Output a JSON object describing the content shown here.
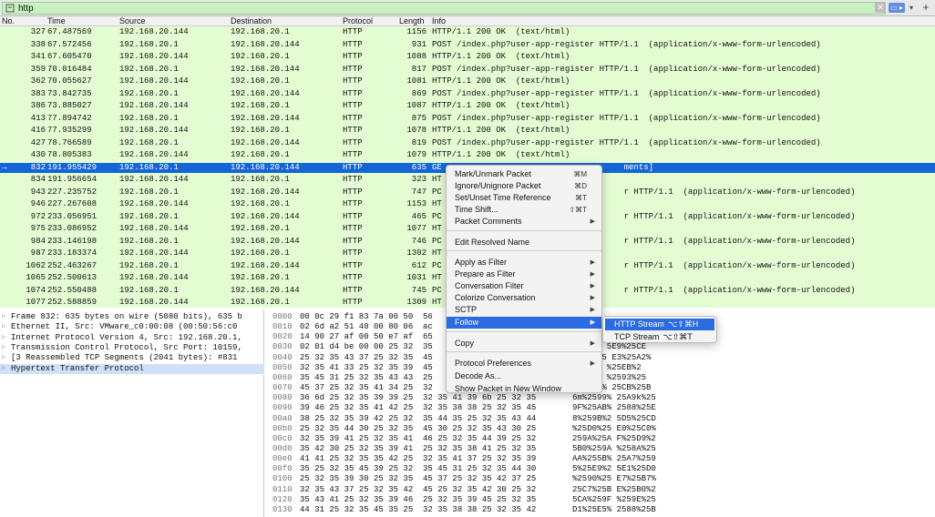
{
  "filter": {
    "value": "http",
    "apply_label": "▭ ▸",
    "clear_label": "✕",
    "dropdown_label": "▾",
    "add_label": "+"
  },
  "columns": [
    "No.",
    "Time",
    "Source",
    "Destination",
    "Protocol",
    "Length",
    "Info"
  ],
  "packets": [
    {
      "no": "327",
      "time": "67.487569",
      "src": "192.168.20.144",
      "dst": "192.168.20.1",
      "proto": "HTTP",
      "len": "1156",
      "info": "HTTP/1.1 200 OK  (text/html)"
    },
    {
      "no": "338",
      "time": "67.572456",
      "src": "192.168.20.1",
      "dst": "192.168.20.144",
      "proto": "HTTP",
      "len": "931",
      "info": "POST /index.php?user-app-register HTTP/1.1  (application/x-www-form-urlencoded)"
    },
    {
      "no": "341",
      "time": "67.605470",
      "src": "192.168.20.144",
      "dst": "192.168.20.1",
      "proto": "HTTP",
      "len": "1088",
      "info": "HTTP/1.1 200 OK  (text/html)"
    },
    {
      "no": "359",
      "time": "70.016484",
      "src": "192.168.20.1",
      "dst": "192.168.20.144",
      "proto": "HTTP",
      "len": "817",
      "info": "POST /index.php?user-app-register HTTP/1.1  (application/x-www-form-urlencoded)"
    },
    {
      "no": "362",
      "time": "70.055627",
      "src": "192.168.20.144",
      "dst": "192.168.20.1",
      "proto": "HTTP",
      "len": "1081",
      "info": "HTTP/1.1 200 OK  (text/html)"
    },
    {
      "no": "383",
      "time": "73.842735",
      "src": "192.168.20.1",
      "dst": "192.168.20.144",
      "proto": "HTTP",
      "len": "869",
      "info": "POST /index.php?user-app-register HTTP/1.1  (application/x-www-form-urlencoded)"
    },
    {
      "no": "386",
      "time": "73.885027",
      "src": "192.168.20.144",
      "dst": "192.168.20.1",
      "proto": "HTTP",
      "len": "1087",
      "info": "HTTP/1.1 200 OK  (text/html)"
    },
    {
      "no": "413",
      "time": "77.894742",
      "src": "192.168.20.1",
      "dst": "192.168.20.144",
      "proto": "HTTP",
      "len": "875",
      "info": "POST /index.php?user-app-register HTTP/1.1  (application/x-www-form-urlencoded)"
    },
    {
      "no": "416",
      "time": "77.935299",
      "src": "192.168.20.144",
      "dst": "192.168.20.1",
      "proto": "HTTP",
      "len": "1078",
      "info": "HTTP/1.1 200 OK  (text/html)"
    },
    {
      "no": "427",
      "time": "78.766589",
      "src": "192.168.20.1",
      "dst": "192.168.20.144",
      "proto": "HTTP",
      "len": "819",
      "info": "POST /index.php?user-app-register HTTP/1.1  (application/x-www-form-urlencoded)"
    },
    {
      "no": "430",
      "time": "78.805383",
      "src": "192.168.20.144",
      "dst": "192.168.20.1",
      "proto": "HTTP",
      "len": "1079",
      "info": "HTTP/1.1 200 OK  (text/html)"
    },
    {
      "no": "832",
      "time": "191.955429",
      "src": "192.168.20.1",
      "dst": "192.168.20.144",
      "proto": "HTTP",
      "len": "635",
      "info": "GE                                     ments]",
      "selected": true
    },
    {
      "no": "834",
      "time": "191.956654",
      "src": "192.168.20.144",
      "dst": "192.168.20.1",
      "proto": "HTTP",
      "len": "323",
      "info": "HT"
    },
    {
      "no": "943",
      "time": "227.235752",
      "src": "192.168.20.1",
      "dst": "192.168.20.144",
      "proto": "HTTP",
      "len": "747",
      "info": "PC                                     r HTTP/1.1  (application/x-www-form-urlencoded)"
    },
    {
      "no": "946",
      "time": "227.267608",
      "src": "192.168.20.144",
      "dst": "192.168.20.1",
      "proto": "HTTP",
      "len": "1153",
      "info": "HT"
    },
    {
      "no": "972",
      "time": "233.056951",
      "src": "192.168.20.1",
      "dst": "192.168.20.144",
      "proto": "HTTP",
      "len": "465",
      "info": "PC                                     r HTTP/1.1  (application/x-www-form-urlencoded)"
    },
    {
      "no": "975",
      "time": "233.086952",
      "src": "192.168.20.144",
      "dst": "192.168.20.1",
      "proto": "HTTP",
      "len": "1077",
      "info": "HT"
    },
    {
      "no": "984",
      "time": "233.146198",
      "src": "192.168.20.1",
      "dst": "192.168.20.144",
      "proto": "HTTP",
      "len": "746",
      "info": "PC                                     r HTTP/1.1  (application/x-www-form-urlencoded)"
    },
    {
      "no": "987",
      "time": "233.183374",
      "src": "192.168.20.144",
      "dst": "192.168.20.1",
      "proto": "HTTP",
      "len": "1302",
      "info": "HT"
    },
    {
      "no": "1062",
      "time": "252.463267",
      "src": "192.168.20.1",
      "dst": "192.168.20.144",
      "proto": "HTTP",
      "len": "612",
      "info": "PC                                     r HTTP/1.1  (application/x-www-form-urlencoded)"
    },
    {
      "no": "1065",
      "time": "252.500613",
      "src": "192.168.20.144",
      "dst": "192.168.20.1",
      "proto": "HTTP",
      "len": "1031",
      "info": "HT"
    },
    {
      "no": "1074",
      "time": "252.550488",
      "src": "192.168.20.1",
      "dst": "192.168.20.144",
      "proto": "HTTP",
      "len": "745",
      "info": "PC                                     r HTTP/1.1  (application/x-www-form-urlencoded)"
    },
    {
      "no": "1077",
      "time": "252.588859",
      "src": "192.168.20.144",
      "dst": "192.168.20.1",
      "proto": "HTTP",
      "len": "1309",
      "info": "HT"
    }
  ],
  "details": [
    {
      "text": "Frame 832: 635 bytes on wire (5080 bits), 635 b"
    },
    {
      "text": "Ethernet II, Src: VMware_c0:00:08 (00:50:56:c0"
    },
    {
      "text": "Internet Protocol Version 4, Src: 192.168.20.1,"
    },
    {
      "text": "Transmission Control Protocol, Src Port: 10159,"
    },
    {
      "text": "[3 Reassembled TCP Segments (2041 bytes): #831"
    },
    {
      "text": "Hypertext Transfer Protocol",
      "selected": true
    }
  ],
  "hex": [
    {
      "off": "0000",
      "bytes": "00 0c 29 f1 83 7a 00 50  56",
      "ascii": ""
    },
    {
      "off": "0010",
      "bytes": "02 6d a2 51 40 00 80 06  ac",
      "ascii": ""
    },
    {
      "off": "0020",
      "bytes": "14 90 27 af 00 50 e7 af  65",
      "ascii": ""
    },
    {
      "off": "0030",
      "bytes": "02 01 d4 be 00 00 25 32  35",
      "ascii": "    %2 5E9%25CE"
    },
    {
      "off": "0040",
      "bytes": "25 32 35 43 37 25 32 35  45",
      "ascii": "    %25 E3%25A2%"
    },
    {
      "off": "0050",
      "bytes": "32 35 41 33 25 32 35 39  45",
      "ascii": "    59 %25EB%2"
    },
    {
      "off": "0060",
      "bytes": "35 45 31 25 32 35 43 43  25",
      "ascii": "    CC %2593%25"
    },
    {
      "off": "0070",
      "bytes": "45 37 25 32 35 41 34 25  32",
      "ascii": "    %4% 25CB%25B"
    },
    {
      "off": "0080",
      "bytes": "36 6d 25 32 35 39 39 25  32 35 41 39 6b 25 32 35",
      "ascii": "6m%2599% 25A9k%25"
    },
    {
      "off": "0090",
      "bytes": "39 46 25 32 35 41 42 25  32 35 38 38 25 32 35 45",
      "ascii": "9F%25AB% 2588%25E"
    },
    {
      "off": "00a0",
      "bytes": "38 25 32 35 39 42 25 32  35 44 35 25 32 35 43 44",
      "ascii": "8%259B%2 5D5%25CD"
    },
    {
      "off": "00b0",
      "bytes": "25 32 35 44 30 25 32 35  45 30 25 32 35 43 30 25",
      "ascii": "%25D0%25 E0%25C0%"
    },
    {
      "off": "00c0",
      "bytes": "32 35 39 41 25 32 35 41  46 25 32 35 44 39 25 32",
      "ascii": "259A%25A F%25D9%2"
    },
    {
      "off": "00d0",
      "bytes": "35 42 30 25 32 35 39 41  25 32 35 38 41 25 32 35",
      "ascii": "5B0%259A %258A%25"
    },
    {
      "off": "00e0",
      "bytes": "41 41 25 32 35 35 42 25  32 35 41 37 25 32 35 39",
      "ascii": "AA%255B% 25A7%259"
    },
    {
      "off": "00f0",
      "bytes": "35 25 32 35 45 39 25 32  35 45 31 25 32 35 44 30",
      "ascii": "5%25E9%2 5E1%25D0"
    },
    {
      "off": "0100",
      "bytes": "25 32 35 39 30 25 32 35  45 37 25 32 35 42 37 25",
      "ascii": "%2590%25 E7%25B7%"
    },
    {
      "off": "0110",
      "bytes": "32 35 43 37 25 32 35 42  45 25 32 35 42 30 25 32",
      "ascii": "25C7%25B E%25B0%2"
    },
    {
      "off": "0120",
      "bytes": "35 43 41 25 32 35 39 46  25 32 35 39 45 25 32 35",
      "ascii": "5CA%259F %259E%25"
    },
    {
      "off": "0130",
      "bytes": "44 31 25 32 35 45 35 25  32 35 38 38 25 32 35 42",
      "ascii": "D1%25E5% 2588%25B"
    }
  ],
  "context_menu": {
    "items": [
      {
        "label": "Mark/Unmark Packet",
        "shortcut": "⌘M"
      },
      {
        "label": "Ignore/Unignore Packet",
        "shortcut": "⌘D"
      },
      {
        "label": "Set/Unset Time Reference",
        "shortcut": "⌘T"
      },
      {
        "label": "Time Shift...",
        "shortcut": "⇧⌘T"
      },
      {
        "label": "Packet Comments",
        "submenu": true
      },
      {
        "label": "Edit Resolved Name"
      },
      {
        "label": "Apply as Filter",
        "submenu": true
      },
      {
        "label": "Prepare as Filter",
        "submenu": true
      },
      {
        "label": "Conversation Filter",
        "submenu": true
      },
      {
        "label": "Colorize Conversation",
        "submenu": true
      },
      {
        "label": "SCTP",
        "submenu": true
      },
      {
        "label": "Follow",
        "submenu": true,
        "highlighted": true
      },
      {
        "label": "Copy",
        "submenu": true
      },
      {
        "label": "Protocol Preferences",
        "submenu": true
      },
      {
        "label": "Decode As..."
      },
      {
        "label": "Show Packet in New Window"
      }
    ]
  },
  "follow_submenu": {
    "items": [
      {
        "label": "HTTP Stream",
        "shortcut": "⌥⇧⌘H",
        "highlighted": true
      },
      {
        "label": "TCP Stream",
        "shortcut": "⌥⇧⌘T"
      }
    ]
  },
  "colors": {
    "list_bg": "#e4fcd2",
    "selected_row": "#1565d8",
    "menu_highlight": "#2c6be0",
    "filter_bg": "#c8f0c0"
  }
}
